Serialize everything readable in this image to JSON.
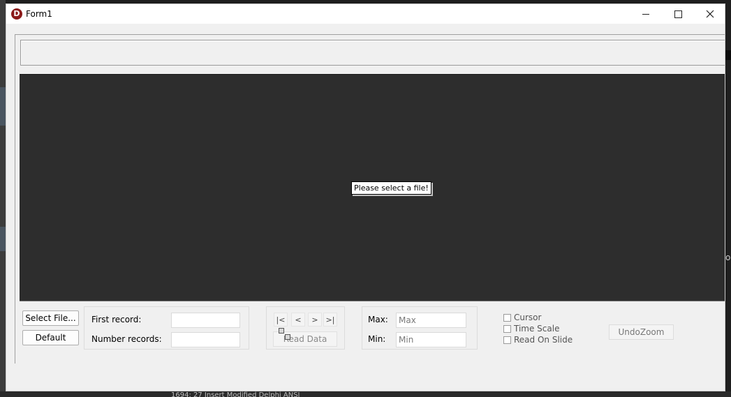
{
  "window": {
    "title": "Form1",
    "icon_letter": "D"
  },
  "chart": {
    "hint_text": "Please select a file!"
  },
  "buttons": {
    "select_file": "Select File...",
    "default": "Default",
    "read_data": "Read Data",
    "undo_zoom": "UndoZoom"
  },
  "records": {
    "first_label": "First record:",
    "first_value": "",
    "number_label": "Number records:",
    "number_value": ""
  },
  "navigation": {
    "first": "|<",
    "prev": "<",
    "next": ">",
    "last": ">|"
  },
  "range": {
    "max_label": "Max:",
    "max_value": "Max",
    "min_label": "Min:",
    "min_value": "Min"
  },
  "options": {
    "cursor": "Cursor",
    "time_scale": "Time Scale",
    "read_on_slide": "Read On Slide"
  },
  "background": {
    "edge_text": "or",
    "status": "1694: 27       Insert         Modified         Delphi          ANSI"
  },
  "colors": {
    "chart_bg": "#2d2d2d",
    "window_bg": "#f0f0f0",
    "app_icon": "#8b1a1a"
  }
}
